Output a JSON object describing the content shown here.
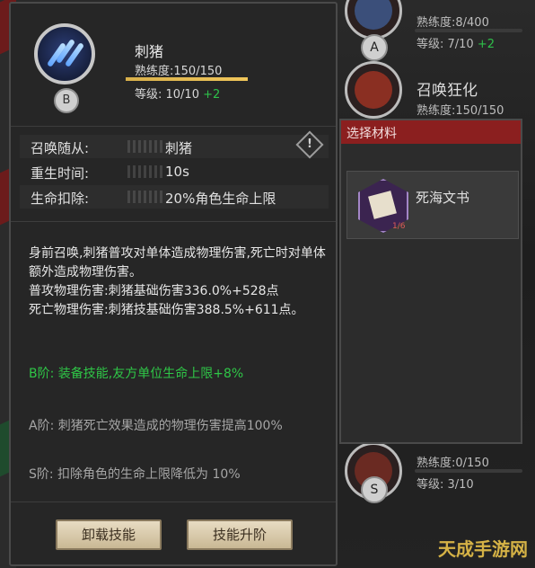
{
  "skill": {
    "name": "刺猪",
    "proficiency_label": "熟练度:150/150",
    "proficiency_fraction": 1.0,
    "level_prefix": "等级: 10/10 ",
    "level_bonus": "+2",
    "rank": "B"
  },
  "attributes": [
    {
      "key": "召唤随从:",
      "value": "刺猪",
      "has_info": true
    },
    {
      "key": "重生时间:",
      "value": "10s"
    },
    {
      "key": "生命扣除:",
      "value": "20%角色生命上限"
    }
  ],
  "info_icon": "!",
  "description": {
    "main": "身前召唤,刺猪普攻对单体造成物理伤害,死亡时对单体额外造成物理伤害。\n普攻物理伤害:刺猪基础伤害336.0%+528点\n死亡物理伤害:刺猪技基础伤害388.5%+611点。",
    "tier_b": "B阶: 装备技能,友方单位生命上限+8%",
    "tier_a": "A阶: 刺猪死亡效果造成的物理伤害提高100%",
    "tier_s": "S阶: 扣除角色的生命上限降低为 10%"
  },
  "buttons": {
    "unequip": "卸载技能",
    "upgrade": "技能升阶"
  },
  "right_list": [
    {
      "proficiency": "熟练度:8/400",
      "level": "等级: 7/10 ",
      "bonus": "+2",
      "rank": "A"
    },
    {
      "name": "召唤狂化",
      "proficiency": "熟练度:150/150"
    },
    {
      "proficiency": "熟练度:0/150",
      "level": "等级: 3/10",
      "rank": "S"
    }
  ],
  "popup": {
    "title": "选择材料",
    "item_name": "死海文书",
    "item_count": "1/6"
  },
  "watermark": "天成手游网"
}
